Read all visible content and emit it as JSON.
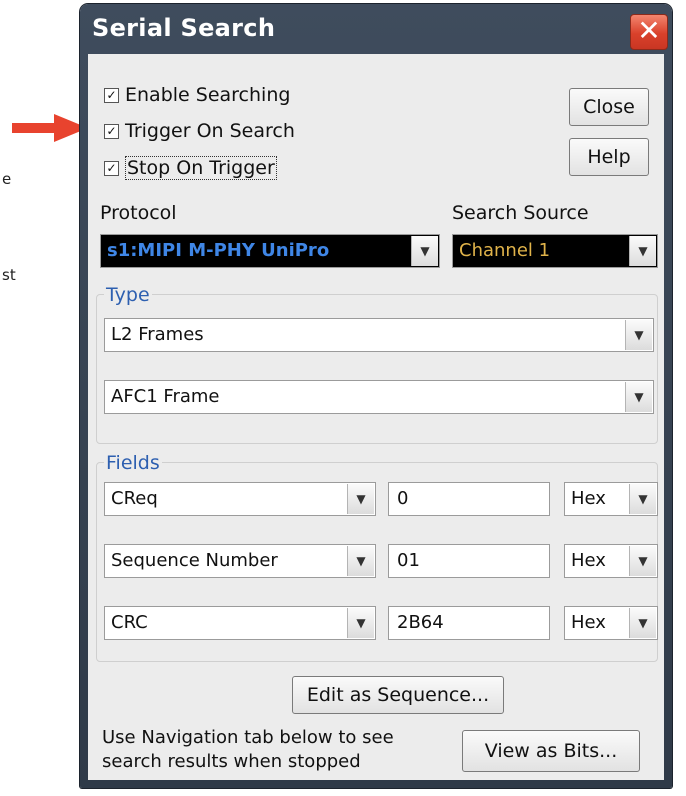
{
  "page_fragments": {
    "line1": "e",
    "line2": "st"
  },
  "window": {
    "title": "Serial Search",
    "close_glyph": "✕"
  },
  "checkboxes": [
    {
      "label": "Enable Searching",
      "checked": true
    },
    {
      "label": "Trigger On Search",
      "checked": true
    },
    {
      "label": "Stop On Trigger",
      "checked": true
    }
  ],
  "buttons": {
    "close": "Close",
    "help": "Help",
    "edit_sequence": "Edit as Sequence...",
    "view_bits": "View as Bits..."
  },
  "protocol": {
    "label": "Protocol",
    "value": "s1:MIPI M-PHY UniPro"
  },
  "search_source": {
    "label": "Search Source",
    "value": "Channel 1"
  },
  "type": {
    "label": "Type",
    "value1": "L2 Frames",
    "value2": "AFC1 Frame"
  },
  "fields": {
    "label": "Fields",
    "rows": [
      {
        "name": "CReq",
        "value": "0",
        "format": "Hex"
      },
      {
        "name": "Sequence Number",
        "value": "01",
        "format": "Hex"
      },
      {
        "name": "CRC",
        "value": "2B64",
        "format": "Hex"
      }
    ]
  },
  "footer": {
    "line1": "Use Navigation tab below to see",
    "line2": "search results when stopped"
  },
  "icons": {
    "dropdown": "chevron-down-icon",
    "arrow_color": "#e8432e"
  }
}
